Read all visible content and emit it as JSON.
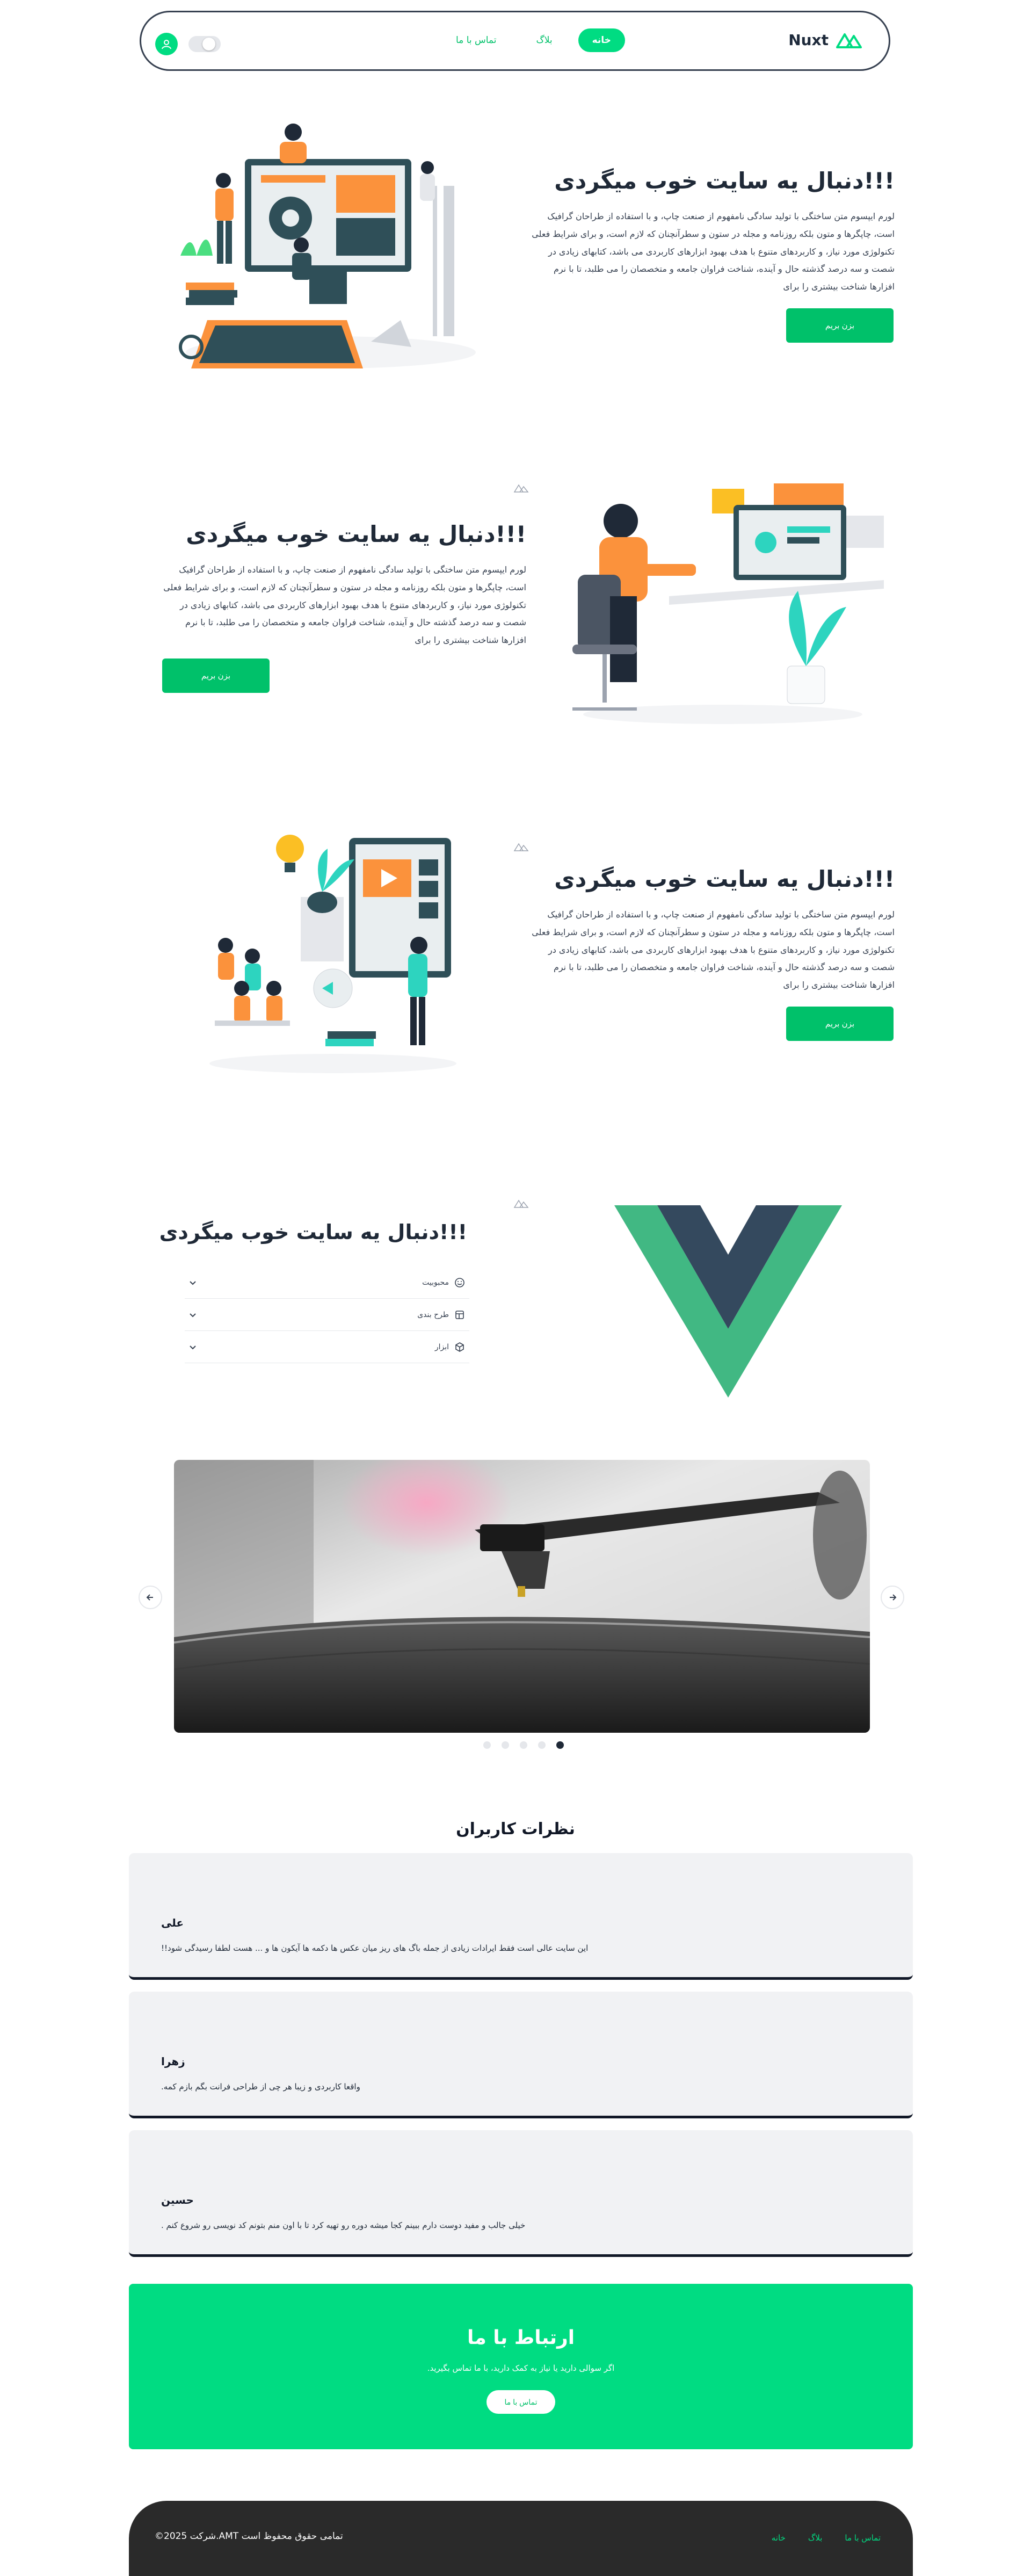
{
  "nav": {
    "brand": "Nuxt",
    "links": [
      "خانه",
      "بلاگ",
      "تماس با ما"
    ],
    "active_link": "خانه"
  },
  "hero": {
    "title": "!!!دنبال یه سایت خوب میگردی",
    "body": "لورم ایپسوم متن ساختگی با تولید سادگی نامفهوم از صنعت چاپ، و با استفاده از طراحان گرافیک است، چاپگرها و متون بلکه روزنامه و مجله در ستون و سطرآنچنان که لازم است، و برای شرایط فعلی تکنولوژی مورد نیاز، و کاربردهای متنوع با هدف بهبود ابزارهای کاربردی می باشد، کتابهای زیادی در شصت و سه درصد گذشته حال و آینده، شناخت فراوان جامعه و متخصصان را می طلبد، تا با نرم افزارها شناخت بیشتری را برای",
    "cta": "بزن بریم"
  },
  "accordion": {
    "title": "!!!دنبال یه سایت خوب میگردی",
    "items": [
      {
        "label": "محبوبیت",
        "icon": "smile-icon"
      },
      {
        "label": "طرح بندی",
        "icon": "layout-icon"
      },
      {
        "label": "ابزار",
        "icon": "box-icon"
      }
    ]
  },
  "carousel": {
    "slides": 5,
    "active": 5
  },
  "comments": {
    "title": "نظرات کاربران",
    "items": [
      {
        "name": "علی",
        "text": "این سایت عالی است فقط ایرادات زیادی از جمله باگ های ریز میان عکس ها دکمه ها آیکون ها و ... هست لطفا رسیدگی شود!!"
      },
      {
        "name": "زهرا",
        "text": "واقعا کاربردی و زیبا هر چی از طراحی فرانت بگم بازم کمه."
      },
      {
        "name": "حسین",
        "text": "خیلی جالب و مفید دوست دارم ببینم کجا میشه دوره رو تهیه کرد تا با اون منم بتونم کد نویسی رو شروع کنم ."
      }
    ]
  },
  "contact": {
    "title": "ارتباط با ما",
    "subtitle": "اگر سوالی دارید یا نیاز به کمک دارید، با ما تماس بگیرید.",
    "button": "تماس با ما"
  },
  "footer": {
    "copyright": "تمامی حقوق محفوظ است AMT.شرکت 2025©",
    "links": [
      "تماس با ما",
      "بلاگ",
      "خانه"
    ]
  },
  "colors": {
    "accent": "#00dc82",
    "accent_dark": "#00c16a",
    "text": "#1f2937",
    "footer_bg": "#2a2a2a"
  }
}
